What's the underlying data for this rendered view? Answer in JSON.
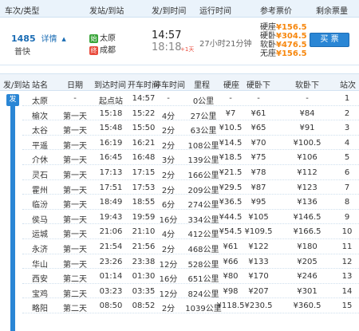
{
  "header": {
    "col_train": "车次/类型",
    "col_stations": "发站/到站",
    "col_times": "发/到时间",
    "col_duration": "运行时间",
    "col_price": "参考票价",
    "col_remain": "剩余票量"
  },
  "train": {
    "number": "1485",
    "detail": "详情",
    "type": "普快",
    "start_badge": "始",
    "end_badge": "终",
    "from": "太原",
    "to": "成都",
    "dep_time": "14:57",
    "arr_time": "18:18",
    "plus_day": "+1天",
    "duration": "27小时21分钟",
    "prices": [
      {
        "label": "硬座",
        "value": "¥156.5"
      },
      {
        "label": "硬卧",
        "value": "¥304.5"
      },
      {
        "label": "软卧",
        "value": "¥476.5"
      },
      {
        "label": "无座",
        "value": "¥156.5"
      }
    ],
    "book": "买 票"
  },
  "table": {
    "columns": [
      "发/到站",
      "站名",
      "日期",
      "到达时间",
      "开车时间",
      "停车时间",
      "里程",
      "硬座",
      "硬卧下",
      "软卧下",
      "站次"
    ],
    "rail_badge": "发",
    "rows": [
      [
        "太原",
        "-",
        "起点站",
        "14:57",
        "-",
        "0公里",
        "-",
        "-",
        "-",
        "1"
      ],
      [
        "榆次",
        "第一天",
        "15:18",
        "15:22",
        "4分",
        "27公里",
        "¥7",
        "¥61",
        "¥84",
        "2"
      ],
      [
        "太谷",
        "第一天",
        "15:48",
        "15:50",
        "2分",
        "63公里",
        "¥10.5",
        "¥65",
        "¥91",
        "3"
      ],
      [
        "平遥",
        "第一天",
        "16:19",
        "16:21",
        "2分",
        "108公里",
        "¥14.5",
        "¥70",
        "¥100.5",
        "4"
      ],
      [
        "介休",
        "第一天",
        "16:45",
        "16:48",
        "3分",
        "139公里",
        "¥18.5",
        "¥75",
        "¥106",
        "5"
      ],
      [
        "灵石",
        "第一天",
        "17:13",
        "17:15",
        "2分",
        "166公里",
        "¥21.5",
        "¥78",
        "¥112",
        "6"
      ],
      [
        "霍州",
        "第一天",
        "17:51",
        "17:53",
        "2分",
        "209公里",
        "¥29.5",
        "¥87",
        "¥123",
        "7"
      ],
      [
        "临汾",
        "第一天",
        "18:49",
        "18:55",
        "6分",
        "274公里",
        "¥36.5",
        "¥95",
        "¥136",
        "8"
      ],
      [
        "侯马",
        "第一天",
        "19:43",
        "19:59",
        "16分",
        "334公里",
        "¥44.5",
        "¥105",
        "¥146.5",
        "9"
      ],
      [
        "运城",
        "第一天",
        "21:06",
        "21:10",
        "4分",
        "412公里",
        "¥54.5",
        "¥109.5",
        "¥166.5",
        "10"
      ],
      [
        "永济",
        "第一天",
        "21:54",
        "21:56",
        "2分",
        "468公里",
        "¥61",
        "¥122",
        "¥180",
        "11"
      ],
      [
        "华山",
        "第一天",
        "23:26",
        "23:38",
        "12分",
        "528公里",
        "¥66",
        "¥133",
        "¥205",
        "12"
      ],
      [
        "西安",
        "第二天",
        "01:14",
        "01:30",
        "16分",
        "651公里",
        "¥80",
        "¥170",
        "¥246",
        "13"
      ],
      [
        "宝鸡",
        "第二天",
        "03:23",
        "03:35",
        "12分",
        "824公里",
        "¥98",
        "¥207",
        "¥301",
        "14"
      ],
      [
        "略阳",
        "第二天",
        "08:50",
        "08:52",
        "2分",
        "1039公里",
        "¥118.5",
        "¥230.5",
        "¥360.5",
        "15"
      ]
    ]
  }
}
